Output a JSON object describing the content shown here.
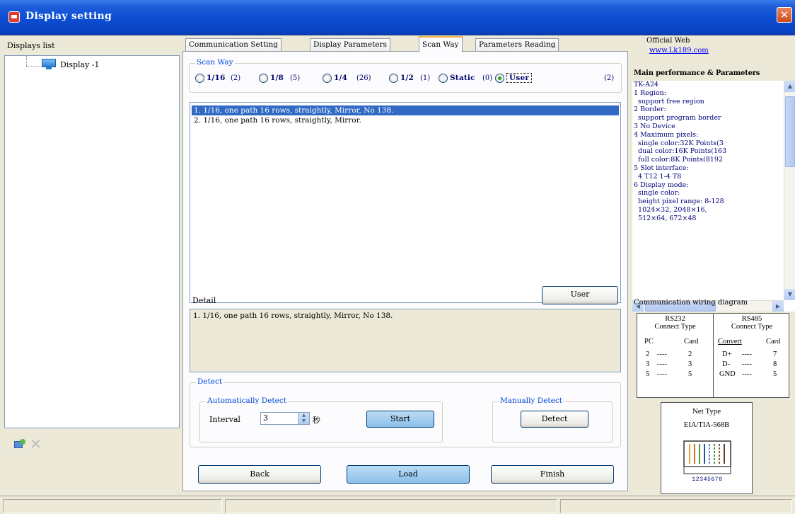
{
  "window": {
    "title": "Display setting",
    "close_label": "✕"
  },
  "left": {
    "label": "Displays list",
    "items": [
      {
        "label": "Display -1"
      }
    ]
  },
  "tabs": [
    {
      "label": "Communication Setting"
    },
    {
      "label": "Display Parameters"
    },
    {
      "label": "Scan Way"
    },
    {
      "label": "Parameters Reading"
    }
  ],
  "scan_way": {
    "group_label": "Scan Way",
    "options": [
      {
        "label": "1/16",
        "count": "(2)",
        "checked": false
      },
      {
        "label": "1/8",
        "count": "(5)",
        "checked": false
      },
      {
        "label": "1/4",
        "count": "(26)",
        "checked": false
      },
      {
        "label": "1/2",
        "count": "(1)",
        "checked": false
      },
      {
        "label": "Static",
        "count": "(0)",
        "checked": false
      },
      {
        "label": "User",
        "count": "(2)",
        "checked": true
      }
    ],
    "list": [
      "1. 1/16, one path 16 rows, straightly, Mirror, No 138.",
      "2. 1/16, one path 16 rows, straightly, Mirror."
    ],
    "selected_index": 0
  },
  "detail": {
    "label": "Detail",
    "user_button": "User",
    "text": "1. 1/16, one path 16 rows, straightly, Mirror, No 138."
  },
  "detect": {
    "group_label": "Detect",
    "auto_label": "Automatically Detect",
    "interval_label": "Interval",
    "interval_value": "3",
    "unit": "秒",
    "start_button": "Start",
    "manual_label": "Manually Detect",
    "detect_button": "Detect"
  },
  "footer": {
    "back": "Back",
    "load": "Load",
    "finish": "Finish"
  },
  "right": {
    "web_label": "Official Web",
    "web_link": "www.Lk189.com",
    "perf_title": "Main performance & Parameters",
    "perf_text": "TK-A24\n1 Region:\n  support free region\n2 Border:\n  support program border\n3 No Device\n4 Maximum pixels:\n  single color:32K Points(3\n  dual color:16K Points(163\n  full color:8K Points(8192\n5 Slot interface:\n  4 T12 1-4 T8\n6 Display mode:\n  single color:\n  height pixel range: 8-128\n  1024×32, 2048×16,\n  512×64, 672×48",
    "wiring_title": "Communication wiring diagram",
    "rs232": {
      "title": "RS232",
      "sub": "Connect Type",
      "left": "PC",
      "right": "Card",
      "rows": [
        [
          "2",
          "2"
        ],
        [
          "3",
          "3"
        ],
        [
          "5",
          "5"
        ]
      ]
    },
    "rs485": {
      "title": "RS485",
      "sub": "Connect Type",
      "left": "Convert",
      "right": "Card",
      "rows": [
        [
          "D+",
          "7"
        ],
        [
          "D-",
          "8"
        ],
        [
          "GND",
          "5"
        ]
      ]
    },
    "net_title": "Net Type",
    "net_sub": "EIA/TIA-568B",
    "net_pins": "12345678"
  }
}
